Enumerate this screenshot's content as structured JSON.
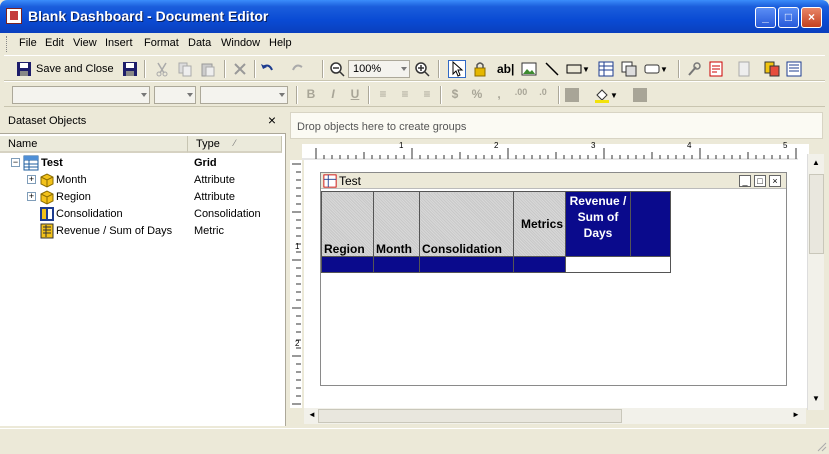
{
  "window": {
    "title": "Blank Dashboard - Document Editor"
  },
  "menu": [
    "File",
    "Edit",
    "View",
    "Insert",
    "Format",
    "Data",
    "Window",
    "Help"
  ],
  "toolbar": {
    "save_close_label": "Save and Close",
    "zoom_value": "100%"
  },
  "dataset": {
    "title": "Dataset Objects",
    "close_glyph": "×",
    "col_name": "Name",
    "col_type": "Type",
    "items": [
      {
        "name": "Test",
        "type": "Grid"
      },
      {
        "name": "Month",
        "type": "Attribute"
      },
      {
        "name": "Region",
        "type": "Attribute"
      },
      {
        "name": "Consolidation",
        "type": "Consolidation"
      },
      {
        "name": "Revenue / Sum of Days",
        "type": "Metric"
      }
    ]
  },
  "layout": {
    "drop_text": "Drop objects here to create groups",
    "ruler_top": [
      "1",
      "2",
      "3",
      "4",
      "5"
    ],
    "ruler_left": [
      "1",
      "2"
    ]
  },
  "grid": {
    "title": "Test",
    "headers": [
      "Region",
      "Month",
      "Consolidation",
      "Metrics"
    ],
    "metric_header": "Revenue / Sum of Days"
  },
  "colors": {
    "titlebar": "#0a4bd4",
    "grid_header": "#0a0a8c"
  }
}
